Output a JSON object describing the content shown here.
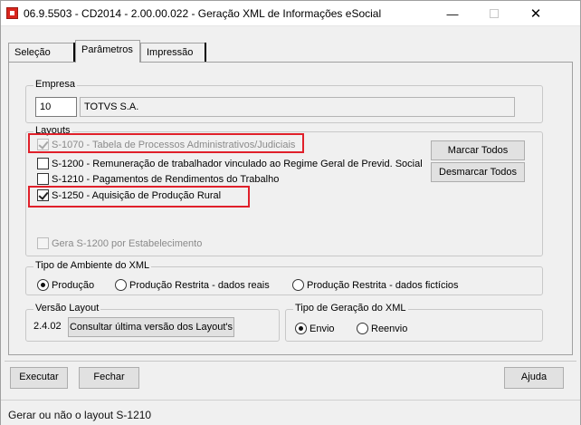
{
  "window": {
    "title": "06.9.5503 - CD2014 - 2.00.00.022 - Geração XML de Informações eSocial",
    "minimize_glyph": "—",
    "close_glyph": "✕"
  },
  "tabs": [
    {
      "label": "Seleção",
      "active": false
    },
    {
      "label": "Parâmetros",
      "active": true
    },
    {
      "label": "Impressão",
      "active": false
    }
  ],
  "empresa": {
    "group_label": "Empresa",
    "code": "10",
    "name": "TOTVS S.A."
  },
  "layouts": {
    "group_label": "Layouts",
    "items": [
      {
        "label": "S-1070 - Tabela de Processos Administrativos/Judiciais",
        "checked": true,
        "enabled": false,
        "highlighted": true
      },
      {
        "label": "S-1200 - Remuneração de trabalhador vinculado ao Regime Geral de Previd. Social",
        "checked": false,
        "enabled": true,
        "highlighted": false
      },
      {
        "label": "S-1210 - Pagamentos de Rendimentos do Trabalho",
        "checked": false,
        "enabled": true,
        "highlighted": false
      },
      {
        "label": "S-1250 - Aquisição de Produção Rural",
        "checked": true,
        "enabled": true,
        "highlighted": true
      }
    ],
    "marcar_todos": "Marcar Todos",
    "desmarcar_todos": "Desmarcar Todos",
    "gera_estabelecimento": {
      "label": "Gera S-1200 por Estabelecimento",
      "checked": false,
      "enabled": false
    },
    "highlight_color": "#e0202a"
  },
  "ambiente": {
    "group_label": "Tipo de Ambiente do XML",
    "options": [
      {
        "label": "Produção",
        "selected": true
      },
      {
        "label": "Produção Restrita - dados reais",
        "selected": false
      },
      {
        "label": "Produção Restrita - dados fictícios",
        "selected": false
      }
    ]
  },
  "versao": {
    "group_label": "Versão Layout",
    "value": "2.4.02",
    "button": "Consultar última versão dos Layout's"
  },
  "geracao": {
    "group_label": "Tipo de Geração do XML",
    "options": [
      {
        "label": "Envio",
        "selected": true
      },
      {
        "label": "Reenvio",
        "selected": false
      }
    ]
  },
  "footer": {
    "executar": "Executar",
    "fechar": "Fechar",
    "ajuda": "Ajuda"
  },
  "status": {
    "text": "Gerar ou não o layout S-1210"
  }
}
